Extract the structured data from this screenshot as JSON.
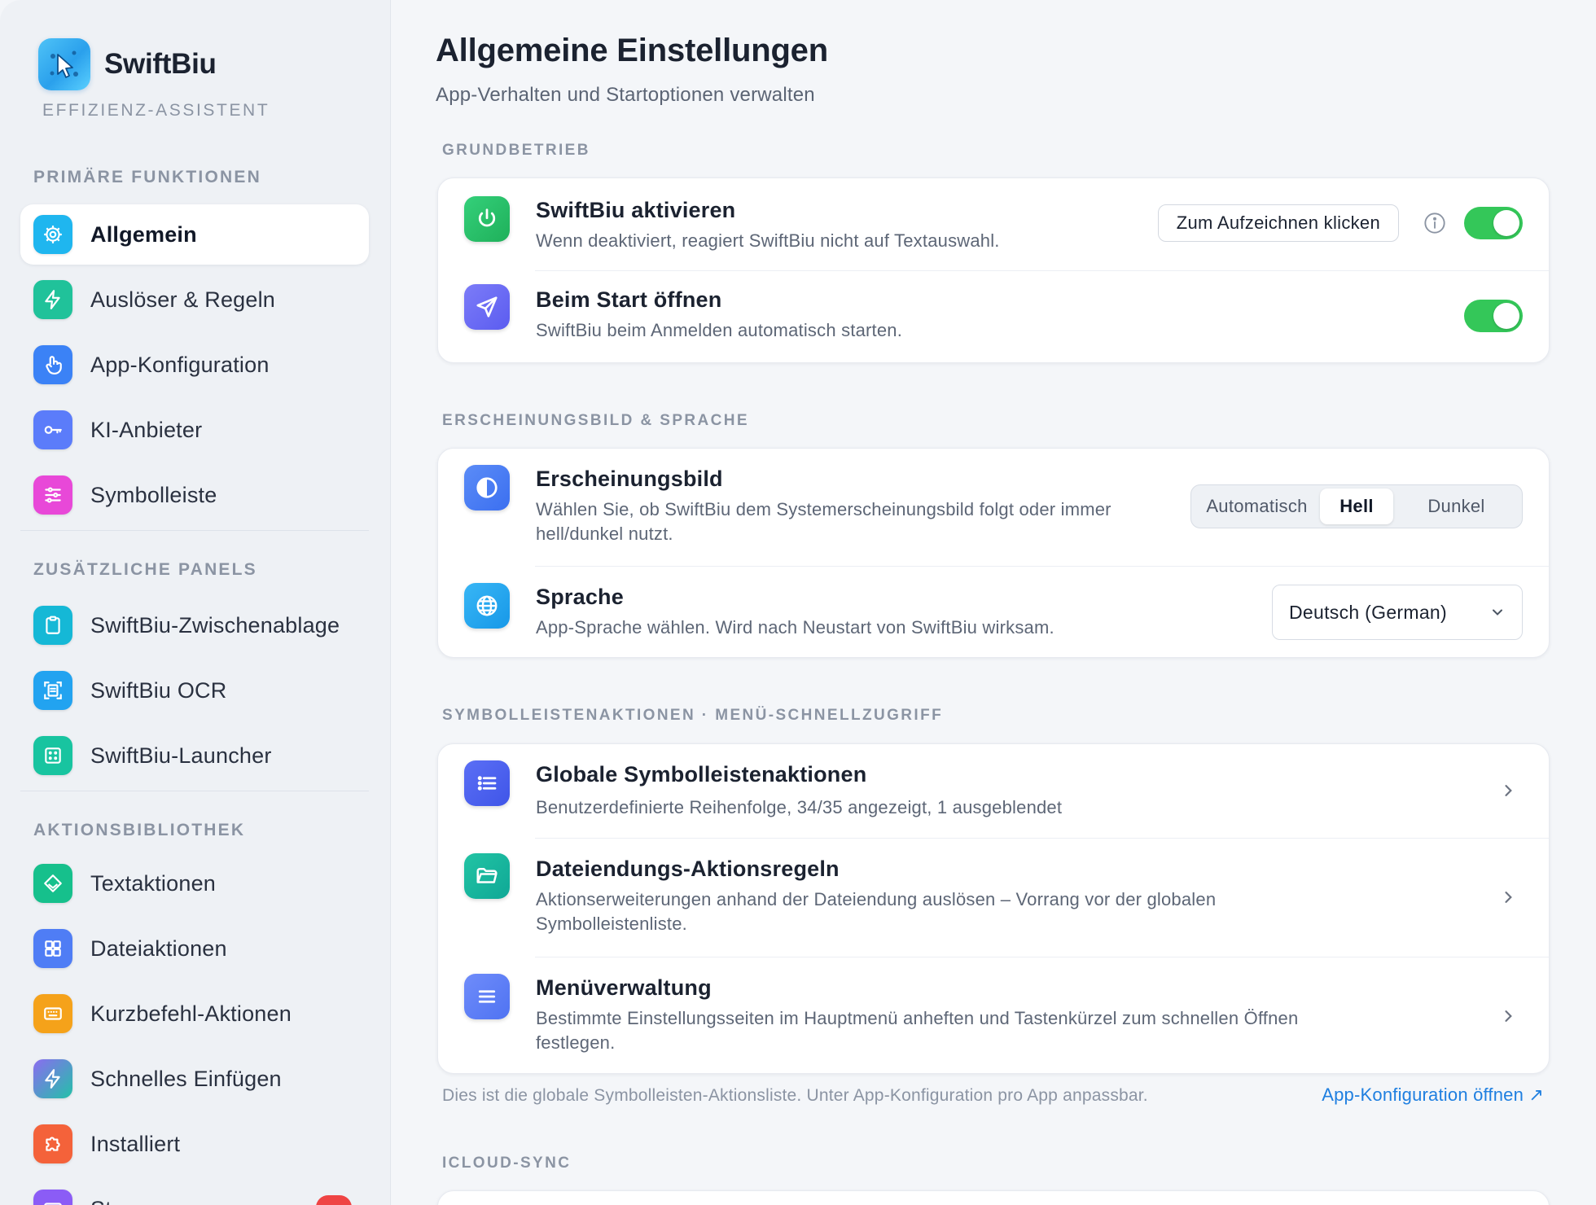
{
  "app": {
    "name": "SwiftBiu",
    "subtitle": "EFFIZIENZ-ASSISTENT"
  },
  "sidebar": {
    "sections": [
      {
        "title": "PRIMÄRE FUNKTIONEN",
        "items": [
          {
            "label": "Allgemein",
            "icon": "gear-icon",
            "color": "#1fb6ef",
            "active": true
          },
          {
            "label": "Auslöser & Regeln",
            "icon": "bolt-icon",
            "color": "#20c29a"
          },
          {
            "label": "App-Konfiguration",
            "icon": "pointer-hand-icon",
            "color": "#3b82f6"
          },
          {
            "label": "KI-Anbieter",
            "icon": "key-icon",
            "color": "#5b7cfa"
          },
          {
            "label": "Symbolleiste",
            "icon": "sliders-icon",
            "color": "#e848d8"
          }
        ]
      },
      {
        "title": "ZUSÄTZLICHE PANELS",
        "items": [
          {
            "label": "SwiftBiu-Zwischenablage",
            "icon": "clipboard-icon",
            "color": "#15b8d6"
          },
          {
            "label": "SwiftBiu OCR",
            "icon": "scan-text-icon",
            "color": "#22a3f0"
          },
          {
            "label": "SwiftBiu-Launcher",
            "icon": "launcher-grid-icon",
            "color": "#18c4a0"
          }
        ]
      },
      {
        "title": "AKTIONSBIBLIOTHEK",
        "items": [
          {
            "label": "Textaktionen",
            "icon": "layers-icon",
            "color": "#16c08c"
          },
          {
            "label": "Dateiaktionen",
            "icon": "grid-icon",
            "color": "#4f7df5"
          },
          {
            "label": "Kurzbefehl-Aktionen",
            "icon": "keyboard-icon",
            "color": "#f5a21a"
          },
          {
            "label": "Schnelles Einfügen",
            "icon": "bolt-icon",
            "color": "#8b6cf0"
          },
          {
            "label": "Installiert",
            "icon": "puzzle-icon",
            "color": "#f4623a"
          }
        ]
      }
    ],
    "partial_item_label": "St"
  },
  "header": {
    "title": "Allgemeine Einstellungen",
    "subtitle": "App-Verhalten und Startoptionen verwalten"
  },
  "sections": {
    "basic": {
      "label": "GRUNDBETRIEB",
      "activate": {
        "title": "SwiftBiu aktivieren",
        "desc": "Wenn deaktiviert, reagiert SwiftBiu nicht auf Textauswahl.",
        "record_button": "Zum Aufzeichnen klicken",
        "enabled": true
      },
      "launch": {
        "title": "Beim Start öffnen",
        "desc": "SwiftBiu beim Anmelden automatisch starten.",
        "enabled": true
      }
    },
    "appearance": {
      "label": "ERSCHEINUNGSBILD & SPRACHE",
      "theme": {
        "title": "Erscheinungsbild",
        "desc_line1": "Wählen Sie, ob SwiftBiu dem Systemerscheinungsbild folgt oder immer",
        "desc_line2": "hell/dunkel nutzt.",
        "options": [
          "Automatisch",
          "Hell",
          "Dunkel"
        ],
        "selected": "Hell"
      },
      "language": {
        "title": "Sprache",
        "desc": "App-Sprache wählen. Wird nach Neustart von SwiftBiu wirksam.",
        "value": "Deutsch (German)"
      }
    },
    "toolbar": {
      "label": "SYMBOLLEISTENAKTIONEN · MENÜ-SCHNELLZUGRIFF",
      "global": {
        "title": "Globale Symbolleistenaktionen",
        "desc": "Benutzerdefinierte Reihenfolge, 34/35 angezeigt, 1 ausgeblendet"
      },
      "file_ext": {
        "title": "Dateiendungs-Aktionsregeln",
        "desc_line1": "Aktionserweiterungen anhand der Dateiendung auslösen – Vorrang vor der globalen",
        "desc_line2": "Symbolleistenliste."
      },
      "menu": {
        "title": "Menüverwaltung",
        "desc_line1": "Bestimmte Einstellungsseiten im Hauptmenü anheften und Tastenkürzel zum schnellen Öffnen",
        "desc_line2": "festlegen."
      },
      "footnote": "Dies ist die globale Symbolleisten-Aktionsliste. Unter App-Konfiguration pro App anpassbar.",
      "link": "App-Konfiguration öffnen ↗"
    },
    "icloud": {
      "label": "ICLOUD-SYNC"
    }
  },
  "colors": {
    "accent": "#1f7fe0",
    "toggle_on": "#34c759",
    "power_icon": "#22c55e",
    "send_icon": "#6d6af5",
    "theme_icon": "#3b82f6",
    "globe_icon": "#1fa4f0",
    "list_icon": "#4f6bf2",
    "folder_icon": "#14b8a6",
    "menu_icon": "#5b7cfa"
  }
}
